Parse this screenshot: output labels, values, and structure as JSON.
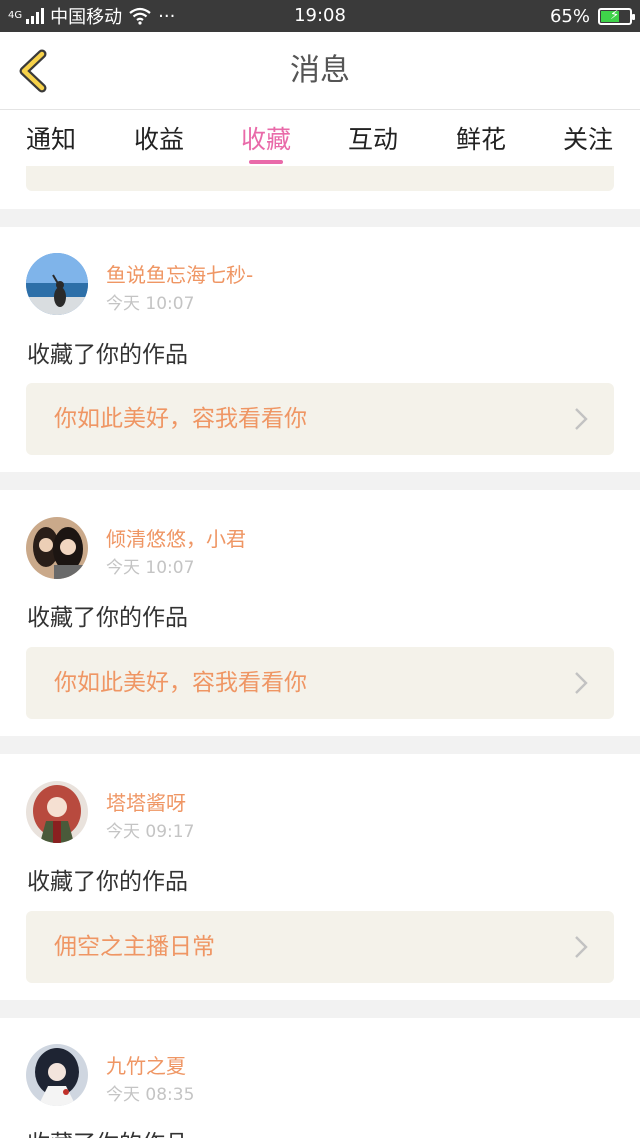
{
  "status_bar": {
    "network": "4G",
    "carrier": "中国移动",
    "time": "19:08",
    "battery": "65%",
    "battery_level": 0.65,
    "more": "···"
  },
  "header": {
    "title": "消息"
  },
  "tabs": [
    {
      "label": "通知"
    },
    {
      "label": "收益"
    },
    {
      "label": "收藏"
    },
    {
      "label": "互动"
    },
    {
      "label": "鲜花"
    },
    {
      "label": "关注"
    }
  ],
  "active_tab": "收藏",
  "colors": {
    "accent_pink": "#e96aa9",
    "name_orange": "#ef9664",
    "card_bg": "#f4f2ea"
  },
  "messages": [
    {
      "username": "鱼说鱼忘海七秒-",
      "time": "今天 10:07",
      "action": "收藏了你的作品",
      "work_title": "你如此美好，容我看看你"
    },
    {
      "username": "倾清悠悠，小君",
      "time": "今天 10:07",
      "action": "收藏了你的作品",
      "work_title": "你如此美好，容我看看你"
    },
    {
      "username": "塔塔酱呀",
      "time": "今天 09:17",
      "action": "收藏了你的作品",
      "work_title": "佣空之主播日常"
    },
    {
      "username": "九竹之夏",
      "time": "今天 08:35",
      "action": "收藏了你的作品",
      "work_title": ""
    }
  ]
}
